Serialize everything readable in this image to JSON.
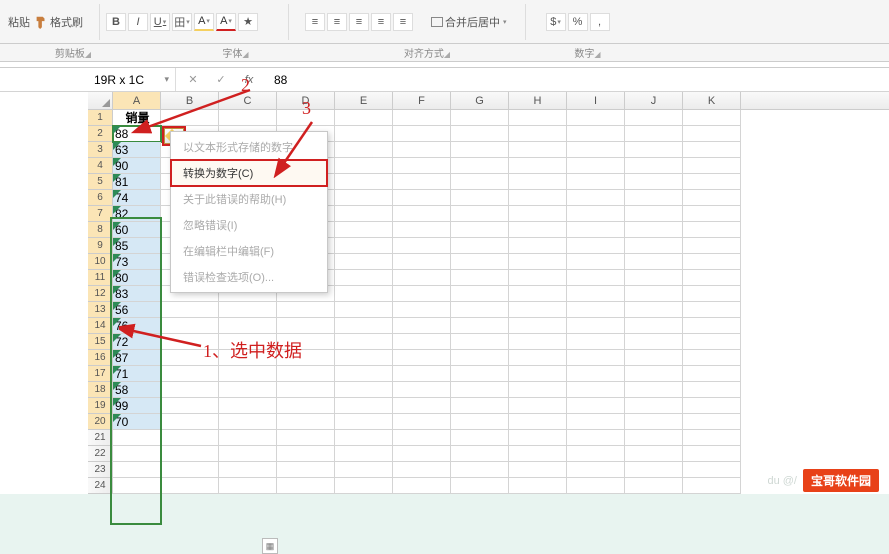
{
  "ribbon": {
    "paste": "粘贴",
    "format_brush": "格式刷",
    "merge_center": "合并后居中",
    "groups": {
      "clipboard": "剪贴板",
      "font": "字体",
      "align": "对齐方式",
      "number": "数字"
    },
    "font_symbols": {
      "bold": "B",
      "italic": "I",
      "underline": "U",
      "border": "田",
      "fill": "A",
      "font_color": "A",
      "erase": "★"
    },
    "num_symbols": {
      "currency": "$",
      "percent": "%",
      "comma": ","
    }
  },
  "name_box": {
    "ref": "19R x 1C",
    "fx": "fx",
    "value": "88",
    "cancel": "✕",
    "confirm": "✓"
  },
  "columns": [
    "A",
    "B",
    "C",
    "D",
    "E",
    "F",
    "G",
    "H",
    "I",
    "J",
    "K"
  ],
  "data_header": "销量",
  "data_values": [
    "88",
    "63",
    "90",
    "81",
    "74",
    "82",
    "60",
    "85",
    "73",
    "80",
    "83",
    "56",
    "76",
    "72",
    "87",
    "71",
    "58",
    "99",
    "70"
  ],
  "row_count": 24,
  "error_menu": {
    "stored_as_text": "以文本形式存储的数字",
    "convert_to_number": "转换为数字(C)",
    "help": "关于此错误的帮助(H)",
    "ignore": "忽略错误(I)",
    "edit_in_bar": "在编辑栏中编辑(F)",
    "error_options": "错误检查选项(O)..."
  },
  "annotations": {
    "step1": "1、选中数据",
    "step2": "2",
    "step3": "3"
  },
  "watermark": {
    "faint": "du @/",
    "badge": "宝哥软件园"
  }
}
